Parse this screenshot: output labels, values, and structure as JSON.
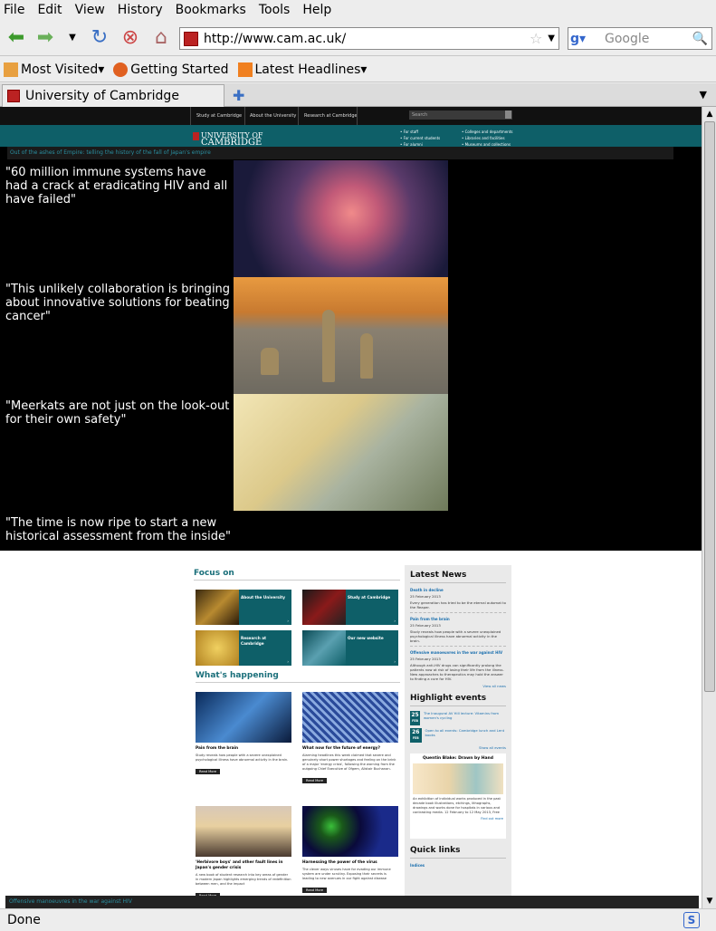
{
  "menu": [
    "File",
    "Edit",
    "View",
    "History",
    "Bookmarks",
    "Tools",
    "Help"
  ],
  "url": "http://www.cam.ac.uk/",
  "search_placeholder": "Google",
  "bookmarks": [
    "Most Visited",
    "Getting Started",
    "Latest Headlines"
  ],
  "tab_title": "University of Cambridge",
  "status": "Done",
  "site": {
    "nav": [
      "Study at Cambridge",
      "About the University",
      "Research at Cambridge"
    ],
    "search_placeholder": "Search",
    "logo_line1": "UNIVERSITY OF",
    "logo_line2": "CAMBRIDGE",
    "links_col1": [
      "For staff",
      "For current students",
      "For alumni"
    ],
    "links_col2": [
      "Colleges and departments",
      "Libraries and facilities",
      "Museums and collections"
    ],
    "slide_caption": "Out of the ashes of Empire: telling the history of the fall of Japan's empire",
    "quotes": [
      "\"60 million immune systems have had a crack at eradicating HIV and all have failed\"",
      "\"This unlikely collaboration is bringing about innovative solutions for beating cancer\"",
      "\"Meerkats are not just on the look-out for their own safety\"",
      "\"The time is now ripe to start a new historical assessment from the inside\""
    ],
    "focus_heading": "Focus on",
    "focus_tiles": [
      "About the University",
      "Study at Cambridge",
      "Research at Cambridge",
      "Our new website"
    ],
    "happening_heading": "What's happening",
    "news": [
      {
        "title": "Pain from the brain",
        "desc": "Study reveals how people with a severe unexplained psychological illness have abnormal activity in the brain.",
        "more": "Read More"
      },
      {
        "title": "What now for the future of energy?",
        "desc": "Alarming headlines this week claimed that severe and genuinely short power shortages and feeling on the brink of a major 'energy crisis', following the warning from the outgoing Chief Executive of Ofgem, Alistair Buchanan.",
        "more": "Read More"
      },
      {
        "title": "'Herbivore boys' and other fault lines in Japan's gender crisis",
        "desc": "A new book of student research into key areas of gender in modern Japan highlights emerging trends of redefinition between men, and the impact",
        "more": "Read More"
      },
      {
        "title": "Harnessing the power of the virus",
        "desc": "The clever ways viruses have for evading our immune system are under scrutiny. Exposing their secrets is leading to new avenues in our fight against disease",
        "more": "Read More"
      }
    ],
    "sidebar": {
      "latest_heading": "Latest News",
      "latest": [
        {
          "title": "Death in decline",
          "date": "25 February 2013",
          "text": "Every generation has tried to be the eternal automat to the Reaper."
        },
        {
          "title": "Pain from the brain",
          "date": "25 February 2013",
          "text": "Study reveals how people with a severe unexplained psychological illness have abnormal activity in the brain."
        },
        {
          "title": "Offensive manoeuvres in the war against HIV",
          "date": "25 February 2013",
          "text": "Although anti-HIV drugs can significantly prolong the patients now at risk of losing their life from the illness. New approaches to therapeutics may hold the answer to finding a cure for HIV."
        }
      ],
      "view_news": "View all news",
      "events_heading": "Highlight events",
      "events": [
        {
          "day": "25",
          "mon": "FEB",
          "title": "The Inaugural AV Hill lecture: Vitamins from women's cycling"
        },
        {
          "day": "26",
          "mon": "FEB",
          "title": "Open to all events: Cambridge lunch and Lent books"
        }
      ],
      "show_events": "Show all events",
      "promo_title": "Quentin Blake: Drawn by Hand",
      "promo_text": "An exhibition of individual works produced in the past decade book illustrations, etchings, lithographs, drawings and works done for hospitals in various and contrasting media. 12 February to 12 May 2013, Free",
      "promo_more": "Find out more",
      "quick_heading": "Quick links",
      "quick_first": "Indices"
    },
    "bottom_caption": "Offensive manoeuvres in the war against HIV"
  }
}
